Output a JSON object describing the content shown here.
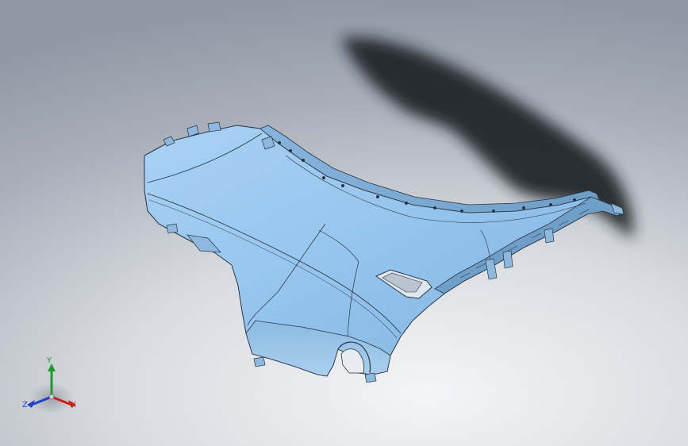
{
  "viewport": {
    "background_top": "#8e97a4",
    "background_bottom": "#f4f5f7"
  },
  "part": {
    "surface_color": "#9cc9f0",
    "surface_light": "#b8dbf8",
    "surface_dark": "#6f9fc8",
    "edge_color": "#2a3440",
    "shadow_color": "#1e2228"
  },
  "triad": {
    "x_label": "X",
    "y_label": "Y",
    "z_label": "Z",
    "x_color": "#c8201c",
    "y_color": "#1f9a2c",
    "z_color": "#2140c8"
  }
}
